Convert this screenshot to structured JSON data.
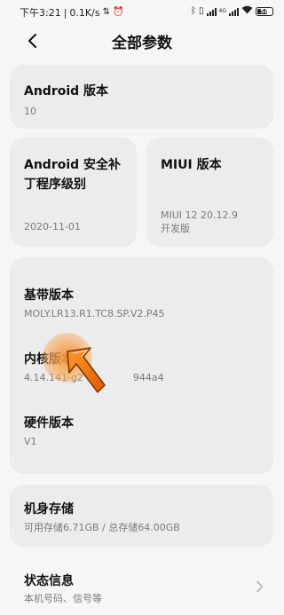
{
  "status_bar": {
    "time": "下午3:21",
    "speed": "0.1K/s",
    "network": "4G",
    "battery": "58"
  },
  "header": {
    "title": "全部参数"
  },
  "android_version": {
    "label": "Android 版本",
    "value": "10"
  },
  "security_patch": {
    "label": "Android 安全补丁程序级别",
    "value": "2020-11-01"
  },
  "miui_version": {
    "label": "MIUI 版本",
    "value_line1": "MIUI 12 20.12.9",
    "value_line2": "开发版"
  },
  "versions": {
    "baseband": {
      "label": "基带版本",
      "value": "MOLY.LR13.R1.TC8.SP.V2.P45"
    },
    "kernel": {
      "label": "内核版本",
      "value": "4.14.141-g2                944a4"
    },
    "hardware": {
      "label": "硬件版本",
      "value": "V1"
    }
  },
  "storage": {
    "label": "机身存储",
    "value": "可用存储6.71GB / 总存储64.00GB"
  },
  "status_info": {
    "label": "状态信息",
    "value": "本机号码、信号等"
  },
  "colors": {
    "background": "#f6f6f6",
    "card": "#ececec",
    "secondary_text": "#7a7a7a",
    "touch_indicator": "#f5912f"
  }
}
